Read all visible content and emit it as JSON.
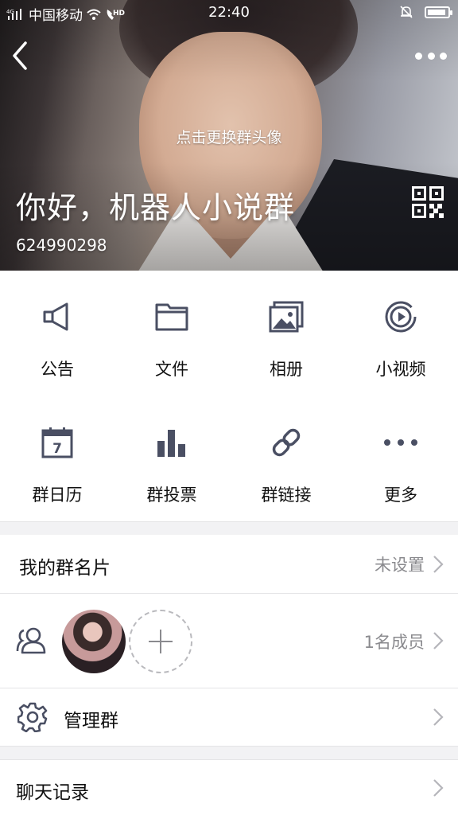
{
  "status_bar": {
    "carrier": "中国移动",
    "network": "4G",
    "hd": "HD",
    "time": "22:40"
  },
  "header": {
    "change_avatar_hint": "点击更换群头像",
    "group_name": "你好，机器人小说群",
    "group_id": "624990298"
  },
  "features": [
    {
      "label": "公告",
      "icon": "megaphone-icon"
    },
    {
      "label": "文件",
      "icon": "folder-icon"
    },
    {
      "label": "相册",
      "icon": "photo-album-icon"
    },
    {
      "label": "小视频",
      "icon": "video-play-icon"
    },
    {
      "label": "群日历",
      "icon": "calendar-icon"
    },
    {
      "label": "群投票",
      "icon": "bar-chart-icon"
    },
    {
      "label": "群链接",
      "icon": "link-icon"
    },
    {
      "label": "更多",
      "icon": "more-dots-icon"
    }
  ],
  "calendar_day": "7",
  "rows": {
    "card": {
      "title": "我的群名片",
      "value": "未设置"
    },
    "members": {
      "count": "1名成员"
    },
    "manage": {
      "title": "管理群"
    },
    "chat_history": {
      "title": "聊天记录"
    }
  },
  "colors": {
    "icon": "#4a4f63",
    "background": "#f2f2f4",
    "secondary_text": "#8a8a8e"
  }
}
